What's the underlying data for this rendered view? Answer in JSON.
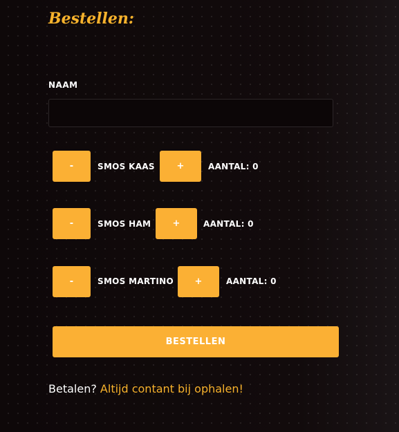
{
  "form": {
    "title": "Bestellen:",
    "naam_label": "NAAM",
    "naam_value": "",
    "products": [
      {
        "minus_label": "-",
        "name": "SMOS KAAS",
        "plus_label": "+",
        "count_text": "AANTAL: 0",
        "count": 0
      },
      {
        "minus_label": "-",
        "name": "SMOS HAM",
        "plus_label": "+",
        "count_text": "AANTAL: 0",
        "count": 0
      },
      {
        "minus_label": "-",
        "name": "SMOS MARTINO",
        "plus_label": "+",
        "count_text": "AANTAL: 0",
        "count": 0
      }
    ],
    "submit_label": "BESTELLEN"
  },
  "payment": {
    "question": "Betalen?",
    "link_text": "Altijd contant bij ophalen!"
  },
  "colors": {
    "accent": "#fbb034",
    "background": "#0e0809",
    "text": "#ffffff"
  }
}
